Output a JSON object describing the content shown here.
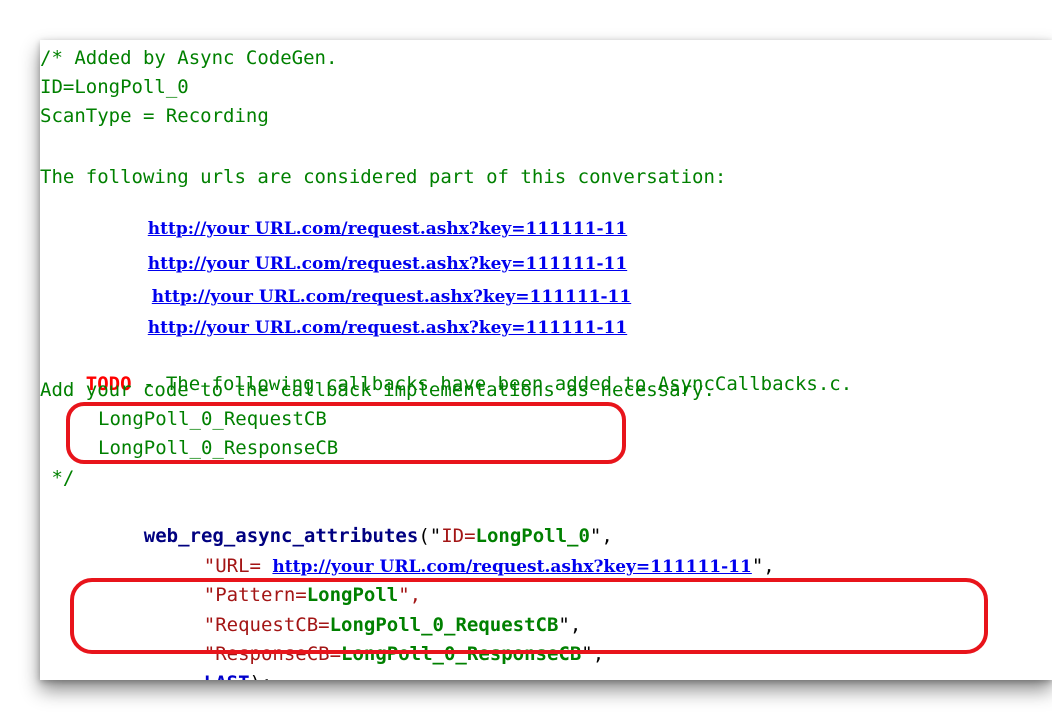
{
  "code": {
    "comment_header": [
      "/* Added by Async CodeGen.",
      "ID=LongPoll_0",
      "ScanType = Recording"
    ],
    "urls_intro": "The following urls are considered part of this conversation:",
    "urls": [
      "http://your URL.com/request.ashx?key=111111-11",
      "http://your URL.com/request.ashx?key=111111-11",
      "http://your URL.com/request.ashx?key=111111-11",
      "http://your URL.com/request.ashx?key=111111-11"
    ],
    "todo_keyword": "TODO",
    "todo_text": " - The following callbacks have been added to AsyncCallbacks.c.",
    "todo_line2": "Add your code to the callback implementations as necessary.",
    "callbacks": [
      "LongPoll_0_RequestCB",
      "LongPoll_0_ResponseCB"
    ],
    "comment_end": " */",
    "call": {
      "function": "web_reg_async_attributes",
      "open": "(\"",
      "id_key": "ID=",
      "id_value": "LongPoll_0",
      "close_comma": "\",",
      "url_key": "\"URL= ",
      "url_value": "http://your URL.com/request.ashx?key=111111-11",
      "url_close": "\",",
      "pattern_key": "\"Pattern=",
      "pattern_value": "LongPoll",
      "pattern_close": "\",",
      "request_key": "\"RequestCB=",
      "request_value": "LongPoll_0_RequestCB",
      "request_close": "\",",
      "response_key": "\"ResponseCB=",
      "response_value": "LongPoll_0_ResponseCB",
      "response_close": "\",",
      "last_keyword": "LAST",
      "last_close": ");"
    }
  },
  "colors": {
    "comment": "#008000",
    "todo": "#ff0000",
    "link": "#0000ee",
    "highlight_oval": "#e8141b"
  }
}
